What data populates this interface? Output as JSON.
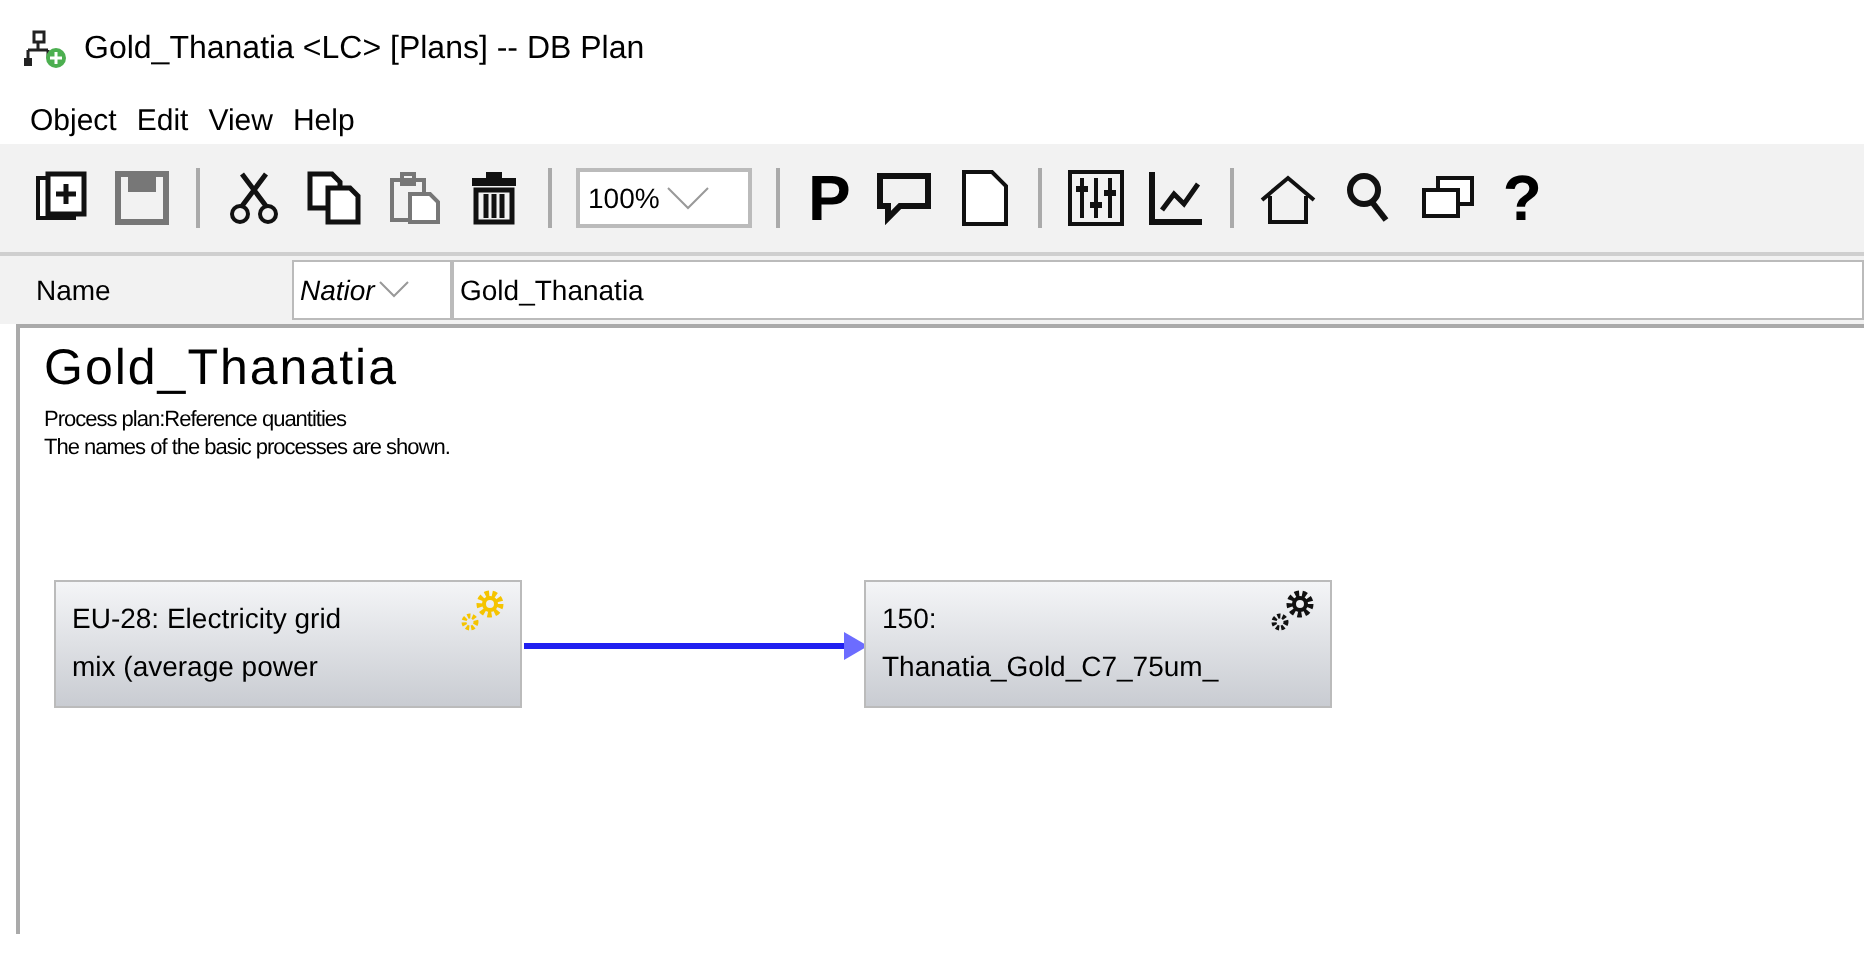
{
  "window": {
    "title": "Gold_Thanatia <LC> [Plans] -- DB Plan"
  },
  "menu": [
    "Object",
    "Edit",
    "View",
    "Help"
  ],
  "toolbar": [
    {
      "kind": "new"
    },
    {
      "kind": "save",
      "disabled": true
    },
    {
      "kind": "sep"
    },
    {
      "kind": "cut"
    },
    {
      "kind": "copy"
    },
    {
      "kind": "paste",
      "disabled": true
    },
    {
      "kind": "delete"
    },
    {
      "kind": "sep"
    },
    {
      "kind": "zoom",
      "value": "100%"
    },
    {
      "kind": "sep"
    },
    {
      "kind": "text",
      "label": "P"
    },
    {
      "kind": "comment"
    },
    {
      "kind": "page"
    },
    {
      "kind": "sep"
    },
    {
      "kind": "sliders"
    },
    {
      "kind": "chart"
    },
    {
      "kind": "sep"
    },
    {
      "kind": "home"
    },
    {
      "kind": "search"
    },
    {
      "kind": "windows"
    },
    {
      "kind": "text",
      "label": "?"
    }
  ],
  "name_row": {
    "label": "Name",
    "language": "Natior",
    "value": "Gold_Thanatia"
  },
  "plan": {
    "title": "Gold_Thanatia",
    "subtitle": "Process plan:Reference quantities",
    "note": "The names of the basic processes are shown.",
    "nodes": [
      {
        "lines": [
          "EU-28: Electricity grid",
          "mix (average power"
        ],
        "color": "#f5c400"
      },
      {
        "lines": [
          "150:",
          "Thanatia_Gold_C7_75um_"
        ],
        "color": "#111111"
      }
    ]
  }
}
